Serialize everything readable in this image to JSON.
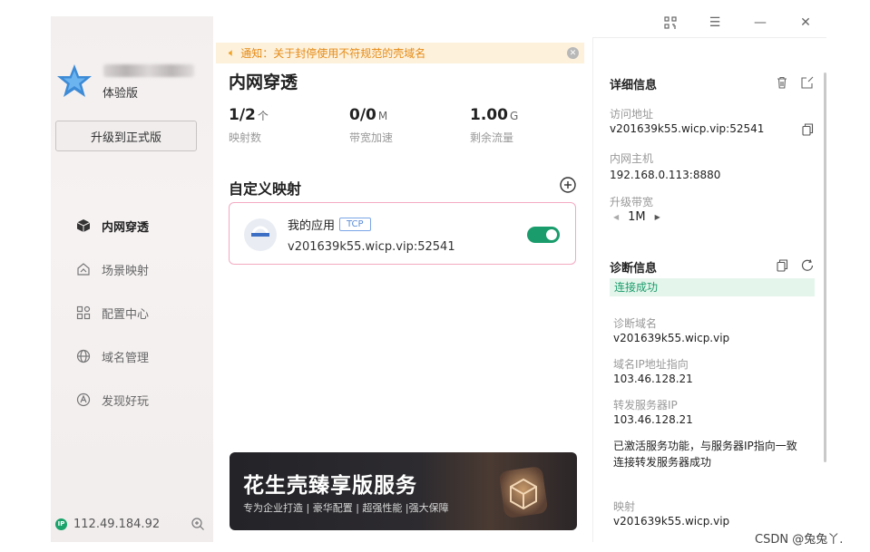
{
  "sidebar": {
    "edition": "体验版",
    "upgrade_label": "升级到正式版",
    "items": [
      {
        "label": "内网穿透",
        "icon": "cube-icon"
      },
      {
        "label": "场景映射",
        "icon": "scene-icon"
      },
      {
        "label": "配置中心",
        "icon": "grid-icon"
      },
      {
        "label": "域名管理",
        "icon": "domain-icon"
      },
      {
        "label": "发现好玩",
        "icon": "discover-icon"
      }
    ],
    "ip_badge": "IP",
    "public_ip": "112.49.184.92"
  },
  "notice": {
    "text": "通知：关于封停使用不符规范的壳域名"
  },
  "main": {
    "title": "内网穿透",
    "stats": [
      {
        "value": "1/2",
        "unit": "个",
        "label": "映射数"
      },
      {
        "value": "0/0",
        "unit": "M",
        "label": "带宽加速"
      },
      {
        "value": "1.00",
        "unit": "G",
        "label": "剩余流量"
      }
    ],
    "section_title": "自定义映射",
    "mapping": {
      "name": "我的应用",
      "protocol": "TCP",
      "address": "v201639k55.wicp.vip:52541",
      "enabled": true
    },
    "banner": {
      "title": "花生壳臻享版服务",
      "subtitle": "专为企业打造 | 豪华配置 | 超强性能 |强大保障"
    }
  },
  "details": {
    "title": "详细信息",
    "access_label": "访问地址",
    "access_value": "v201639k55.wicp.vip:52541",
    "host_label": "内网主机",
    "host_value": "192.168.0.113:8880",
    "bandwidth_label": "升级带宽",
    "bandwidth_value": "1M"
  },
  "diagnosis": {
    "title": "诊断信息",
    "status": "连接成功",
    "domain_label": "诊断域名",
    "domain_value": "v201639k55.wicp.vip",
    "ip_label": "域名IP地址指向",
    "ip_value": "103.46.128.21",
    "fwd_label": "转发服务器IP",
    "fwd_value": "103.46.128.21",
    "message_line1": "已激活服务功能，与服务器IP指向一致",
    "message_line2": "连接转发服务器成功",
    "map_label": "映射",
    "map_value": "v201639k55.wicp.vip"
  },
  "watermark": "CSDN @兔兔丫.",
  "colors": {
    "accent": "#1a9c6c",
    "notice": "#e58b16",
    "card_border": "#f3a9c1"
  }
}
